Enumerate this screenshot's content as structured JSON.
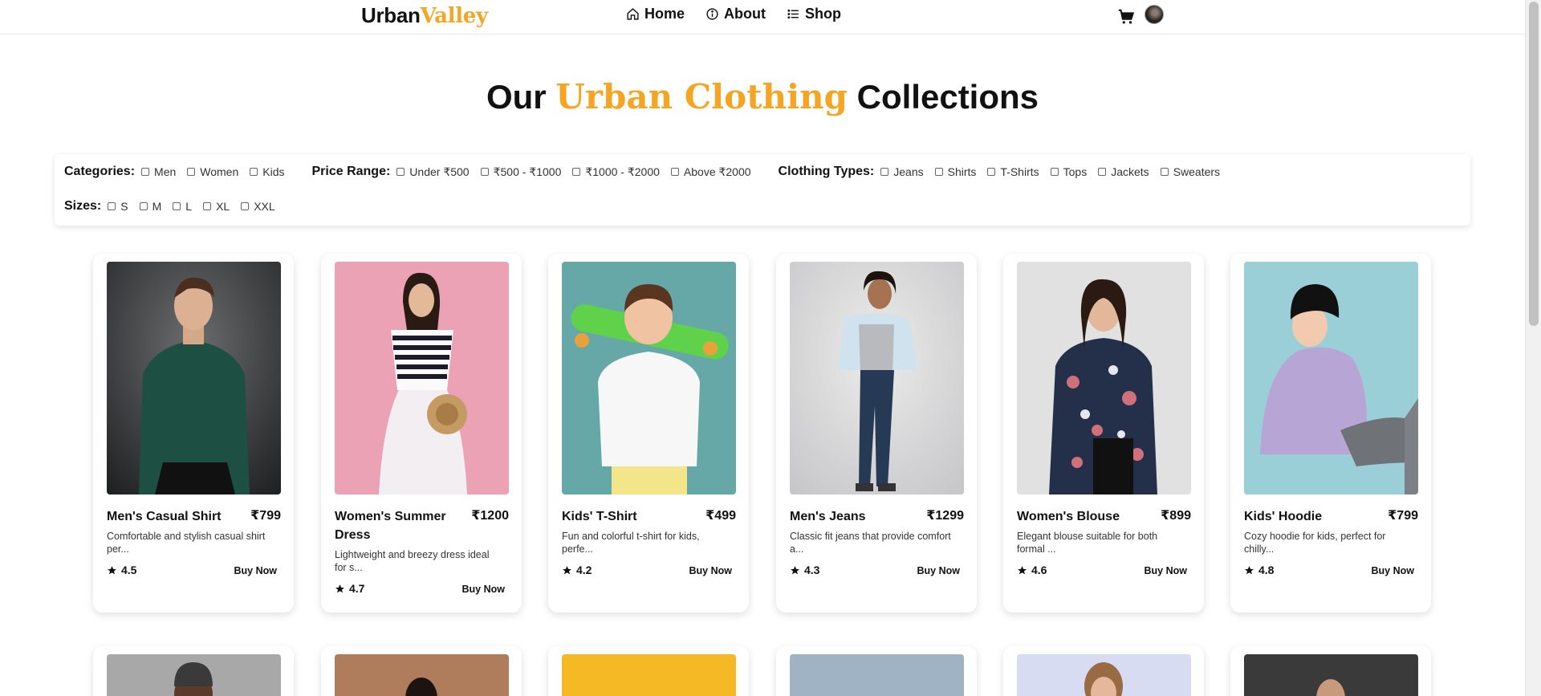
{
  "header": {
    "logo_dark": "Urban",
    "logo_gold": "Valley",
    "nav": [
      {
        "label": "Home",
        "icon": "home-icon"
      },
      {
        "label": "About",
        "icon": "info-icon"
      },
      {
        "label": "Shop",
        "icon": "list-icon"
      }
    ],
    "cart_icon": "cart-icon",
    "avatar_icon": "avatar"
  },
  "title": {
    "part1": "Our ",
    "highlight": "Urban Clothing",
    "part2": " Collections"
  },
  "filters": {
    "categories": {
      "label": "Categories:",
      "options": [
        "Men",
        "Women",
        "Kids"
      ]
    },
    "price": {
      "label": "Price Range:",
      "options": [
        "Under ₹500",
        "₹500 - ₹1000",
        "₹1000 - ₹2000",
        "Above ₹2000"
      ]
    },
    "types": {
      "label": "Clothing Types:",
      "options": [
        "Jeans",
        "Shirts",
        "T-Shirts",
        "Tops",
        "Jackets",
        "Sweaters"
      ]
    },
    "sizes": {
      "label": "Sizes:",
      "options": [
        "S",
        "M",
        "L",
        "XL",
        "XXL"
      ]
    }
  },
  "products": [
    {
      "name": "Men's Casual Shirt",
      "price": "₹799",
      "desc_1": "Comfortable and stylish casual shirt",
      "desc_2": "per...",
      "rating": "4.5",
      "buy": "Buy Now"
    },
    {
      "name": "Women's Summer Dress",
      "price": "₹1200",
      "desc_1": "Lightweight and breezy dress ideal",
      "desc_2": "for s...",
      "rating": "4.7",
      "buy": "Buy Now"
    },
    {
      "name": "Kids' T-Shirt",
      "price": "₹499",
      "desc_1": "Fun and colorful t-shirt for kids,",
      "desc_2": "perfe...",
      "rating": "4.2",
      "buy": "Buy Now"
    },
    {
      "name": "Men's Jeans",
      "price": "₹1299",
      "desc_1": "Classic fit jeans that provide comfort",
      "desc_2": "a...",
      "rating": "4.3",
      "buy": "Buy Now"
    },
    {
      "name": "Women's Blouse",
      "price": "₹899",
      "desc_1": "Elegant blouse suitable for both",
      "desc_2": "formal ...",
      "rating": "4.6",
      "buy": "Buy Now"
    },
    {
      "name": "Kids' Hoodie",
      "price": "₹799",
      "desc_1": "Cozy hoodie for kids, perfect for",
      "desc_2": "chilly...",
      "rating": "4.8",
      "buy": "Buy Now"
    }
  ],
  "colors": {
    "accent": "#f5a524",
    "text": "#111111"
  }
}
